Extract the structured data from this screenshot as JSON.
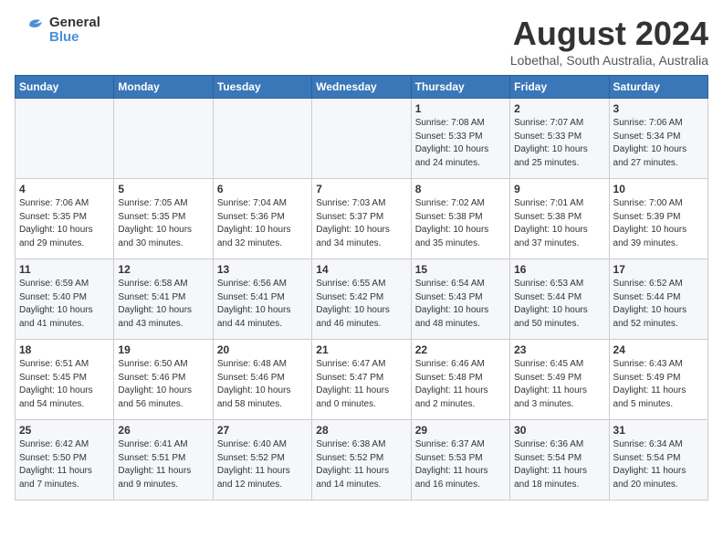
{
  "header": {
    "logo_general": "General",
    "logo_blue": "Blue",
    "title": "August 2024",
    "subtitle": "Lobethal, South Australia, Australia"
  },
  "days_of_week": [
    "Sunday",
    "Monday",
    "Tuesday",
    "Wednesday",
    "Thursday",
    "Friday",
    "Saturday"
  ],
  "weeks": [
    [
      {
        "day": "",
        "info": ""
      },
      {
        "day": "",
        "info": ""
      },
      {
        "day": "",
        "info": ""
      },
      {
        "day": "",
        "info": ""
      },
      {
        "day": "1",
        "info": "Sunrise: 7:08 AM\nSunset: 5:33 PM\nDaylight: 10 hours\nand 24 minutes."
      },
      {
        "day": "2",
        "info": "Sunrise: 7:07 AM\nSunset: 5:33 PM\nDaylight: 10 hours\nand 25 minutes."
      },
      {
        "day": "3",
        "info": "Sunrise: 7:06 AM\nSunset: 5:34 PM\nDaylight: 10 hours\nand 27 minutes."
      }
    ],
    [
      {
        "day": "4",
        "info": "Sunrise: 7:06 AM\nSunset: 5:35 PM\nDaylight: 10 hours\nand 29 minutes."
      },
      {
        "day": "5",
        "info": "Sunrise: 7:05 AM\nSunset: 5:35 PM\nDaylight: 10 hours\nand 30 minutes."
      },
      {
        "day": "6",
        "info": "Sunrise: 7:04 AM\nSunset: 5:36 PM\nDaylight: 10 hours\nand 32 minutes."
      },
      {
        "day": "7",
        "info": "Sunrise: 7:03 AM\nSunset: 5:37 PM\nDaylight: 10 hours\nand 34 minutes."
      },
      {
        "day": "8",
        "info": "Sunrise: 7:02 AM\nSunset: 5:38 PM\nDaylight: 10 hours\nand 35 minutes."
      },
      {
        "day": "9",
        "info": "Sunrise: 7:01 AM\nSunset: 5:38 PM\nDaylight: 10 hours\nand 37 minutes."
      },
      {
        "day": "10",
        "info": "Sunrise: 7:00 AM\nSunset: 5:39 PM\nDaylight: 10 hours\nand 39 minutes."
      }
    ],
    [
      {
        "day": "11",
        "info": "Sunrise: 6:59 AM\nSunset: 5:40 PM\nDaylight: 10 hours\nand 41 minutes."
      },
      {
        "day": "12",
        "info": "Sunrise: 6:58 AM\nSunset: 5:41 PM\nDaylight: 10 hours\nand 43 minutes."
      },
      {
        "day": "13",
        "info": "Sunrise: 6:56 AM\nSunset: 5:41 PM\nDaylight: 10 hours\nand 44 minutes."
      },
      {
        "day": "14",
        "info": "Sunrise: 6:55 AM\nSunset: 5:42 PM\nDaylight: 10 hours\nand 46 minutes."
      },
      {
        "day": "15",
        "info": "Sunrise: 6:54 AM\nSunset: 5:43 PM\nDaylight: 10 hours\nand 48 minutes."
      },
      {
        "day": "16",
        "info": "Sunrise: 6:53 AM\nSunset: 5:44 PM\nDaylight: 10 hours\nand 50 minutes."
      },
      {
        "day": "17",
        "info": "Sunrise: 6:52 AM\nSunset: 5:44 PM\nDaylight: 10 hours\nand 52 minutes."
      }
    ],
    [
      {
        "day": "18",
        "info": "Sunrise: 6:51 AM\nSunset: 5:45 PM\nDaylight: 10 hours\nand 54 minutes."
      },
      {
        "day": "19",
        "info": "Sunrise: 6:50 AM\nSunset: 5:46 PM\nDaylight: 10 hours\nand 56 minutes."
      },
      {
        "day": "20",
        "info": "Sunrise: 6:48 AM\nSunset: 5:46 PM\nDaylight: 10 hours\nand 58 minutes."
      },
      {
        "day": "21",
        "info": "Sunrise: 6:47 AM\nSunset: 5:47 PM\nDaylight: 11 hours\nand 0 minutes."
      },
      {
        "day": "22",
        "info": "Sunrise: 6:46 AM\nSunset: 5:48 PM\nDaylight: 11 hours\nand 2 minutes."
      },
      {
        "day": "23",
        "info": "Sunrise: 6:45 AM\nSunset: 5:49 PM\nDaylight: 11 hours\nand 3 minutes."
      },
      {
        "day": "24",
        "info": "Sunrise: 6:43 AM\nSunset: 5:49 PM\nDaylight: 11 hours\nand 5 minutes."
      }
    ],
    [
      {
        "day": "25",
        "info": "Sunrise: 6:42 AM\nSunset: 5:50 PM\nDaylight: 11 hours\nand 7 minutes."
      },
      {
        "day": "26",
        "info": "Sunrise: 6:41 AM\nSunset: 5:51 PM\nDaylight: 11 hours\nand 9 minutes."
      },
      {
        "day": "27",
        "info": "Sunrise: 6:40 AM\nSunset: 5:52 PM\nDaylight: 11 hours\nand 12 minutes."
      },
      {
        "day": "28",
        "info": "Sunrise: 6:38 AM\nSunset: 5:52 PM\nDaylight: 11 hours\nand 14 minutes."
      },
      {
        "day": "29",
        "info": "Sunrise: 6:37 AM\nSunset: 5:53 PM\nDaylight: 11 hours\nand 16 minutes."
      },
      {
        "day": "30",
        "info": "Sunrise: 6:36 AM\nSunset: 5:54 PM\nDaylight: 11 hours\nand 18 minutes."
      },
      {
        "day": "31",
        "info": "Sunrise: 6:34 AM\nSunset: 5:54 PM\nDaylight: 11 hours\nand 20 minutes."
      }
    ]
  ]
}
